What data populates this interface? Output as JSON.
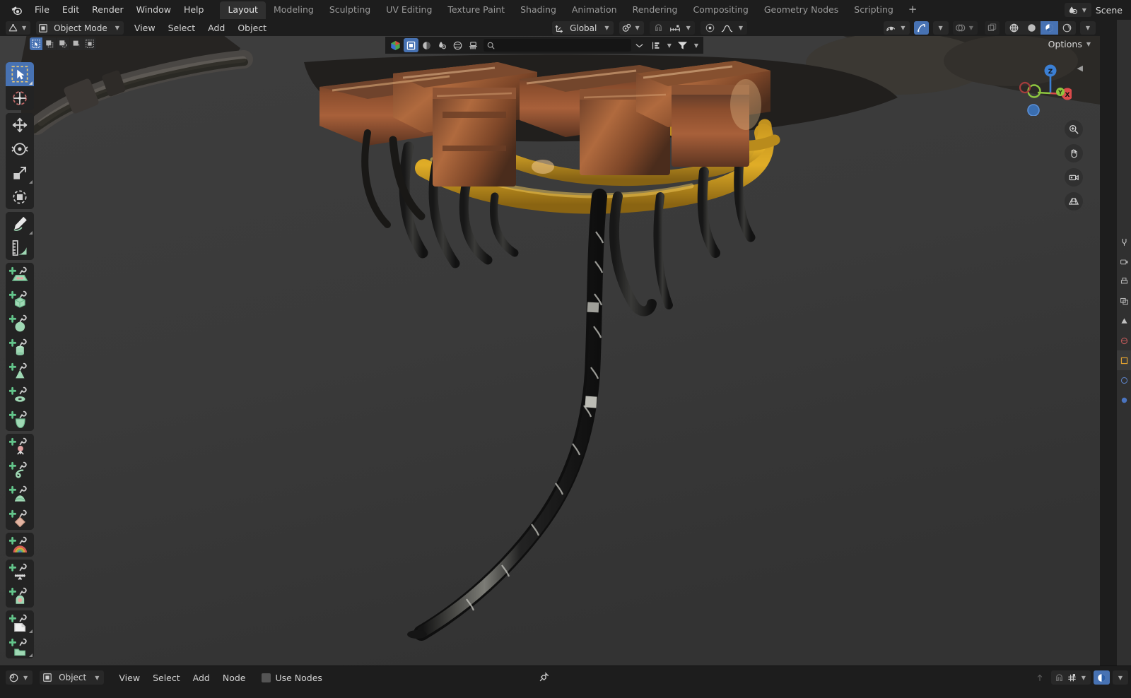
{
  "app": {
    "name": "Blender",
    "logo_icon": "blender-logo-icon"
  },
  "topbar": {
    "menus": [
      "File",
      "Edit",
      "Render",
      "Window",
      "Help"
    ],
    "workspaces": [
      {
        "label": "Layout",
        "active": true
      },
      {
        "label": "Modeling",
        "active": false
      },
      {
        "label": "Sculpting",
        "active": false
      },
      {
        "label": "UV Editing",
        "active": false
      },
      {
        "label": "Texture Paint",
        "active": false
      },
      {
        "label": "Shading",
        "active": false
      },
      {
        "label": "Animation",
        "active": false
      },
      {
        "label": "Rendering",
        "active": false
      },
      {
        "label": "Compositing",
        "active": false
      },
      {
        "label": "Geometry Nodes",
        "active": false
      },
      {
        "label": "Scripting",
        "active": false
      }
    ],
    "add_workspace_label": "+",
    "scene": {
      "label": "Scene",
      "icon": "scene-data-icon"
    }
  },
  "viewport_header": {
    "editor_type_icon": "editor-type-3dview-icon",
    "mode": {
      "label": "Object Mode",
      "icon": "object-mode-icon"
    },
    "menus": [
      "View",
      "Select",
      "Add",
      "Object"
    ],
    "transform_orientation": {
      "label": "Global",
      "icon": "orientation-icon"
    },
    "pivot_point": {
      "icon": "pivot-point-icon"
    },
    "snap": {
      "magnet_icon": "magnet-icon",
      "snap_to_icon": "snap-increment-icon"
    },
    "proportional_edit": {
      "toggle_icon": "proportional-edit-icon",
      "falloff_icon": "smooth-falloff-icon"
    },
    "visibility": {
      "icon": "show-hide-icon"
    },
    "gizmo": {
      "icon": "gizmo-icon",
      "enabled": true
    },
    "overlays": {
      "icon": "overlays-icon",
      "enabled": false
    },
    "xray": {
      "icon": "xray-toggle-icon",
      "enabled": false
    },
    "shading_modes": [
      {
        "name": "wireframe",
        "icon": "shading-wireframe-icon",
        "active": false
      },
      {
        "name": "solid",
        "icon": "shading-solid-icon",
        "active": false
      },
      {
        "name": "material-preview",
        "icon": "shading-material-icon",
        "active": true
      },
      {
        "name": "rendered",
        "icon": "shading-rendered-icon",
        "active": false
      }
    ],
    "shading_dropdown_icon": "chevron-down-icon"
  },
  "select_modes": [
    {
      "name": "tweak",
      "icon": "select-tweak-icon",
      "active": true
    },
    {
      "name": "select-box",
      "icon": "select-box-icon",
      "active": false
    },
    {
      "name": "select-circle",
      "icon": "select-circle-icon",
      "active": false
    },
    {
      "name": "select-lasso",
      "icon": "select-lasso-icon",
      "active": false
    },
    {
      "name": "select-extend",
      "icon": "select-extend-icon",
      "active": false
    }
  ],
  "options": {
    "label": "Options",
    "chevron": "chevron-down-icon"
  },
  "outliner_filter_bar": {
    "display_mode_icon": "outliner-scenes-icon",
    "toggles": [
      {
        "name": "restrict-select",
        "icon": "restrict-select-icon",
        "active": true
      },
      {
        "name": "restrict-hide",
        "icon": "restrict-hide-icon",
        "active": false
      },
      {
        "name": "restrict-viewport",
        "icon": "restrict-viewport-icon",
        "active": false
      },
      {
        "name": "restrict-render",
        "icon": "restrict-render-icon",
        "active": false
      },
      {
        "name": "restrict-brush",
        "icon": "restrict-brush-icon",
        "active": false
      }
    ],
    "search": {
      "placeholder": "",
      "value": "",
      "icon": "search-icon"
    },
    "collapse_icon": "collapse-all-icon",
    "sort_icon": "sort-alpha-icon",
    "filter_icon": "filter-funnel-icon"
  },
  "toolbar": {
    "groups": [
      {
        "tools": [
          {
            "name": "tweak-tool",
            "icon": "cursor-arrow-icon",
            "active": true,
            "has_submenu": true
          },
          {
            "name": "cursor-tool",
            "icon": "3d-cursor-icon",
            "active": false,
            "has_submenu": false
          }
        ]
      },
      {
        "tools": [
          {
            "name": "move-tool",
            "icon": "move-arrows-icon",
            "active": false,
            "has_submenu": false
          },
          {
            "name": "rotate-tool",
            "icon": "rotate-icon",
            "active": false,
            "has_submenu": false
          },
          {
            "name": "scale-tool",
            "icon": "scale-icon",
            "active": false,
            "has_submenu": true
          },
          {
            "name": "transform-tool",
            "icon": "transform-icon",
            "active": false,
            "has_submenu": false
          }
        ]
      },
      {
        "tools": [
          {
            "name": "annotate-tool",
            "icon": "annotate-pencil-icon",
            "active": false,
            "has_submenu": true
          },
          {
            "name": "measure-tool",
            "icon": "measure-ruler-icon",
            "active": false,
            "has_submenu": false
          }
        ]
      },
      {
        "tools": [
          {
            "name": "add-plane-tool",
            "icon": "add-plane-icon",
            "active": false,
            "has_submenu": false
          },
          {
            "name": "add-cube-tool",
            "icon": "add-cube-icon",
            "active": false,
            "has_submenu": false
          },
          {
            "name": "add-sphere-tool",
            "icon": "add-uvsphere-icon",
            "active": false,
            "has_submenu": false
          },
          {
            "name": "add-cylinder-tool",
            "icon": "add-cylinder-icon",
            "active": false,
            "has_submenu": false
          },
          {
            "name": "add-cone-tool",
            "icon": "add-cone-icon",
            "active": false,
            "has_submenu": false
          },
          {
            "name": "add-torus-tool",
            "icon": "add-torus-icon",
            "active": false,
            "has_submenu": false
          },
          {
            "name": "add-monkey-tool",
            "icon": "add-monkey-icon",
            "active": false,
            "has_submenu": false
          }
        ]
      },
      {
        "tools": [
          {
            "name": "add-empty-tool",
            "icon": "add-empty-icon",
            "active": false,
            "has_submenu": false
          },
          {
            "name": "add-curve-tool",
            "icon": "add-curve-icon",
            "active": false,
            "has_submenu": false
          },
          {
            "name": "add-metaball-tool",
            "icon": "add-metaball-icon",
            "active": false,
            "has_submenu": false
          },
          {
            "name": "add-surface-tool",
            "icon": "add-surface-icon",
            "active": false,
            "has_submenu": false
          }
        ]
      },
      {
        "tools": [
          {
            "name": "add-light-tool",
            "icon": "add-light-rainbow-icon",
            "active": false,
            "has_submenu": false
          }
        ]
      },
      {
        "tools": [
          {
            "name": "add-armature-tool",
            "icon": "add-armature-icon",
            "active": false,
            "has_submenu": false
          },
          {
            "name": "add-volume-tool",
            "icon": "add-volume-icon",
            "active": false,
            "has_submenu": false
          }
        ]
      },
      {
        "tools": [
          {
            "name": "add-grease-pencil-tool",
            "icon": "add-greasepencil-icon",
            "active": false,
            "has_submenu": true
          },
          {
            "name": "add-collection-tool",
            "icon": "add-collection-icon",
            "active": false,
            "has_submenu": true
          }
        ]
      }
    ]
  },
  "nav_gizmo": {
    "axes": [
      {
        "label": "Z",
        "color": "#3b7fd4",
        "name": "axis-z-positive"
      },
      {
        "label": "Y",
        "color": "#8dc63f",
        "name": "axis-y-positive"
      },
      {
        "label": "X",
        "color": "#e04a4a",
        "name": "axis-x-positive"
      }
    ],
    "negative_axes": [
      {
        "name": "axis-x-negative",
        "color": "#7c2d2d"
      },
      {
        "name": "axis-z-negative",
        "color": "#2f5c94"
      }
    ],
    "buttons": [
      {
        "name": "zoom-button",
        "icon": "zoom-magnifier-icon"
      },
      {
        "name": "pan-button",
        "icon": "hand-pan-icon"
      },
      {
        "name": "camera-view-button",
        "icon": "camera-icon"
      },
      {
        "name": "toggle-ortho-button",
        "icon": "grid-perspective-icon"
      }
    ]
  },
  "properties_tabs": [
    {
      "name": "tool-tab",
      "icon": "tool-icon",
      "active": false
    },
    {
      "name": "render-tab",
      "icon": "render-camera-icon",
      "active": false
    },
    {
      "name": "output-tab",
      "icon": "printer-icon",
      "active": false
    },
    {
      "name": "view-layer-tab",
      "icon": "images-icon",
      "active": false
    },
    {
      "name": "scene-tab",
      "icon": "scene-cone-icon",
      "active": false
    },
    {
      "name": "world-tab",
      "icon": "world-globe-icon",
      "active": false
    },
    {
      "name": "object-tab",
      "icon": "object-square-icon",
      "active": true
    },
    {
      "name": "modifiers-tab",
      "icon": "wrench-icon",
      "active": false
    },
    {
      "name": "physics-tab",
      "icon": "physics-orbit-icon",
      "active": false
    }
  ],
  "shader_editor": {
    "editor_type_icon": "editor-type-shader-icon",
    "shader_type": {
      "label": "Object",
      "icon": "object-shader-icon"
    },
    "menus": [
      "View",
      "Select",
      "Add",
      "Node"
    ],
    "use_nodes": {
      "label": "Use Nodes",
      "checked": false
    },
    "pin_icon": "pin-icon",
    "right_controls": [
      {
        "name": "go-to-parent-button",
        "icon": "arrow-up-icon",
        "enabled": false
      },
      {
        "name": "snap-magnet-toggle",
        "icon": "magnet-icon",
        "enabled": false
      },
      {
        "name": "snap-node-element",
        "icon": "snap-grid-icon",
        "enabled": false
      },
      {
        "name": "shading-preview-toggle",
        "icon": "shading-material-icon",
        "enabled": true
      }
    ]
  },
  "scene_render": {
    "description": "Dark grey 3D viewport with a material-preview rendered model of a copper/bronze mechanical rig with yellow-gold cables and dangling dark striped tentacle-like cords.",
    "background_color": "#3b3b3b",
    "accent_blue": "#4772b3"
  }
}
